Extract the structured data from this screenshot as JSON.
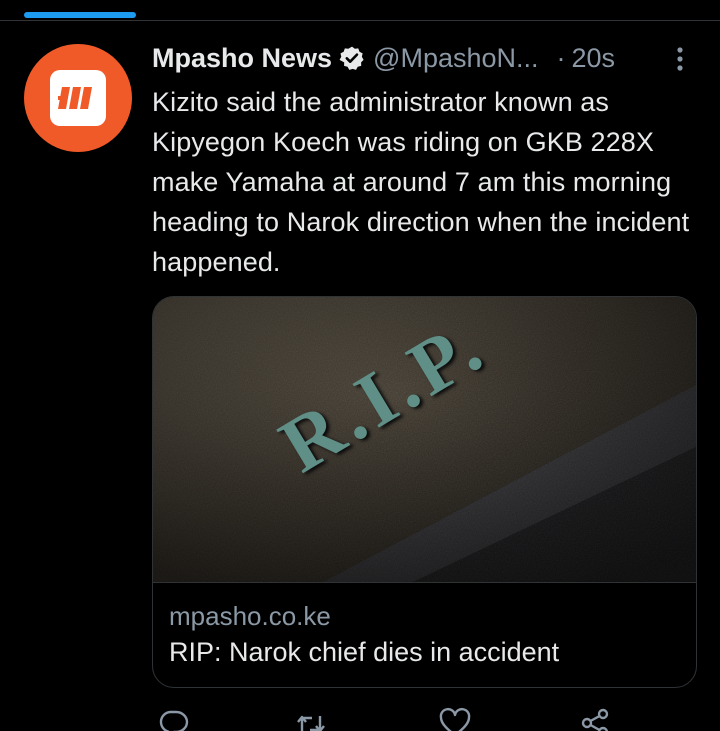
{
  "colors": {
    "accent": "#1d9bf0",
    "brand_avatar": "#f05a28",
    "text_primary": "#e7e9ea",
    "text_secondary": "#8b98a5",
    "border": "#2f3336"
  },
  "tweet": {
    "display_name": "Mpasho News",
    "verified_icon": "verified-badge-icon",
    "handle": "@MpashoN...",
    "separator": "·",
    "time": "20s",
    "more_icon": "more-vertical-icon",
    "text": "Kizito said the administrator known as Kipyegon Koech was riding on GKB 228X make Yamaha at around 7 am this morning heading to Narok direction when the incident happened."
  },
  "link_card": {
    "image_text": "R.I.P.",
    "domain": "mpasho.co.ke",
    "title": "RIP: Narok chief dies in accident"
  },
  "actions": {
    "reply_icon": "reply-icon",
    "retweet_icon": "retweet-icon",
    "like_icon": "heart-icon",
    "share_icon": "share-icon"
  }
}
